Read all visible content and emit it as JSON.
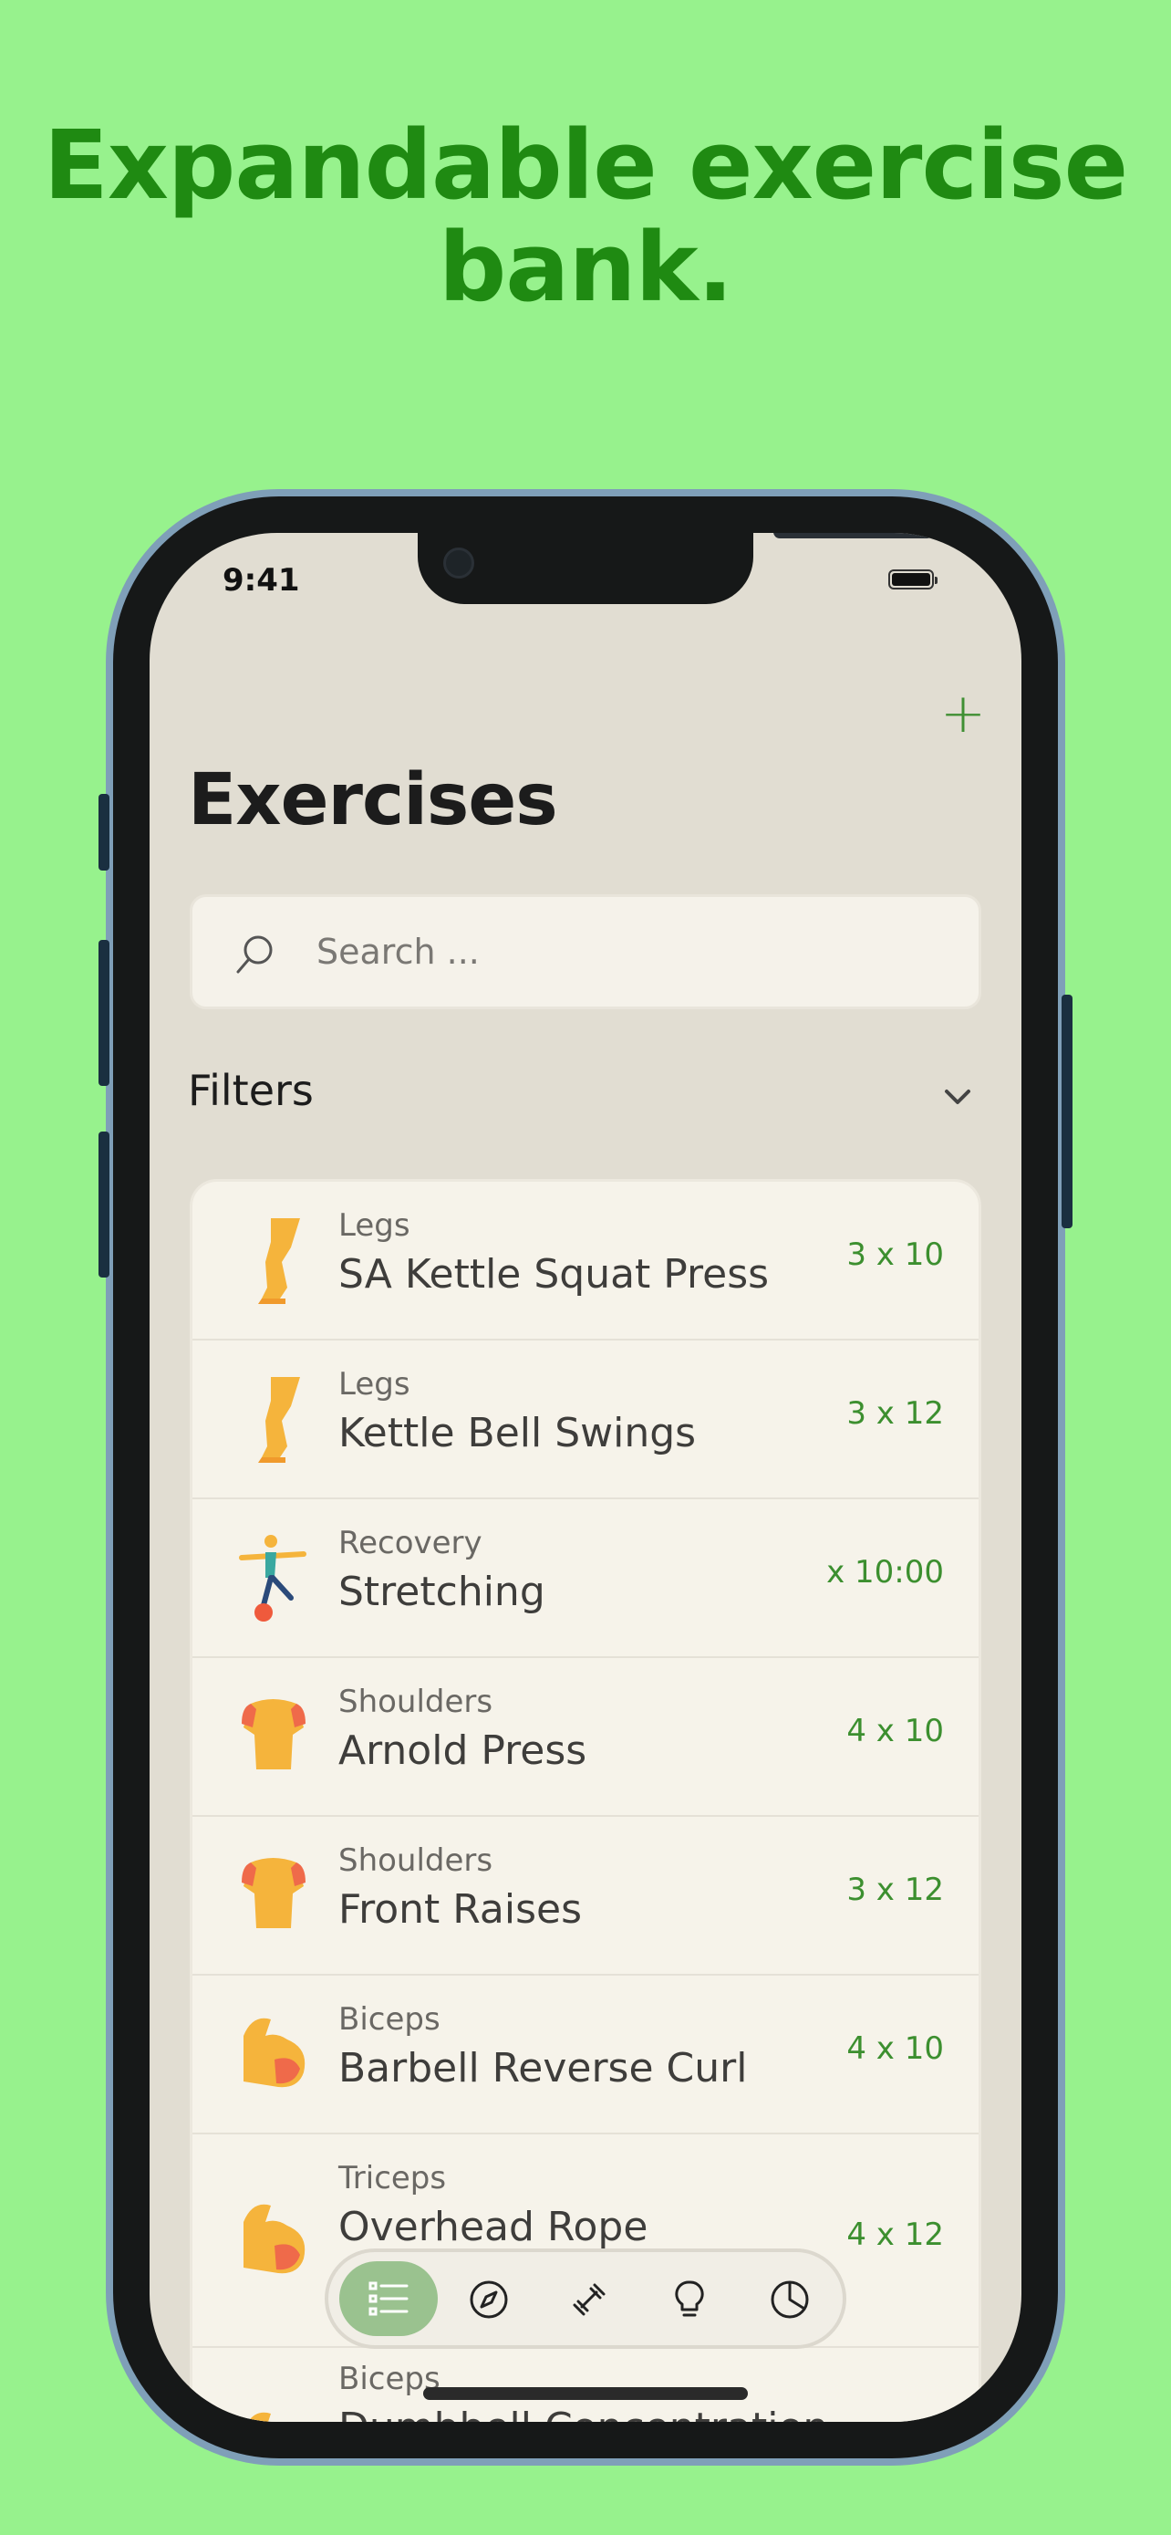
{
  "headline": "Expandable exercise bank.",
  "status_bar": {
    "time": "9:41"
  },
  "screen": {
    "title": "Exercises",
    "add_button": "+",
    "search": {
      "placeholder": "Search ..."
    },
    "filters": {
      "label": "Filters"
    },
    "exercises": [
      {
        "category": "Legs",
        "name": "SA Kettle Squat Press",
        "sets": "3 x 10",
        "icon": "leg-icon"
      },
      {
        "category": "Legs",
        "name": "Kettle Bell Swings",
        "sets": "3 x 12",
        "icon": "leg-icon"
      },
      {
        "category": "Recovery",
        "name": "Stretching",
        "sets": "x 10:00",
        "icon": "balance-figure-icon"
      },
      {
        "category": "Shoulders",
        "name": "Arnold Press",
        "sets": "4 x 10",
        "icon": "shoulders-icon"
      },
      {
        "category": "Shoulders",
        "name": "Front Raises",
        "sets": "3 x 12",
        "icon": "shoulders-icon"
      },
      {
        "category": "Biceps",
        "name": "Barbell Reverse Curl",
        "sets": "4 x 10",
        "icon": "flexed-bicep-icon"
      },
      {
        "category": "Triceps",
        "name": "Overhead Rope",
        "sets": "4 x 12",
        "icon": "flexed-bicep-icon"
      },
      {
        "category": "Biceps",
        "name": "Dumbbell Concentration",
        "sets": "",
        "icon": "flexed-bicep-icon"
      }
    ],
    "tabbar": {
      "tabs": [
        {
          "name": "list-icon",
          "active": true
        },
        {
          "name": "compass-icon",
          "active": false
        },
        {
          "name": "dumbbell-icon",
          "active": false
        },
        {
          "name": "lightbulb-icon",
          "active": false
        },
        {
          "name": "pie-chart-icon",
          "active": false
        }
      ]
    }
  },
  "colors": {
    "background": "#97f28d",
    "headline": "#1f8a12",
    "accent": "#3c8f2f",
    "active_tab": "#9ac28f"
  }
}
